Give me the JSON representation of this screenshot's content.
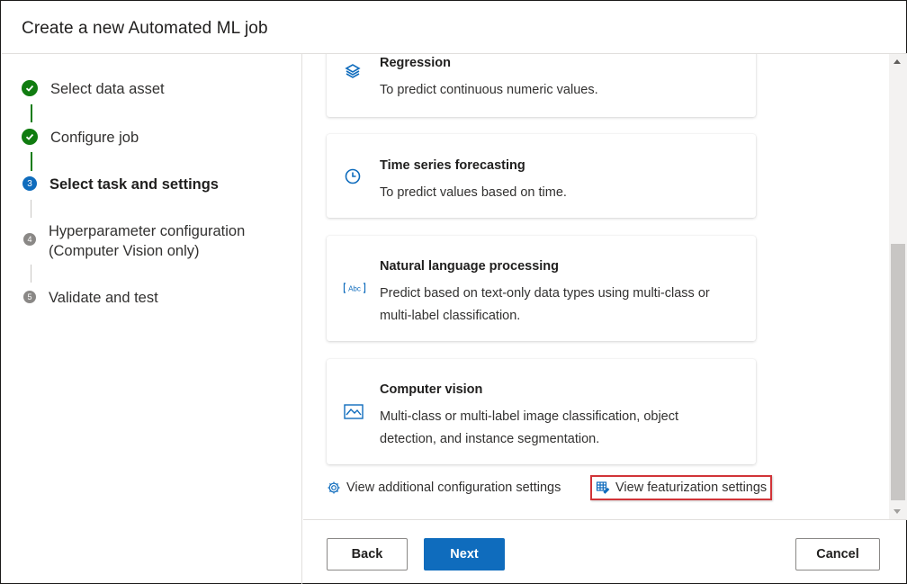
{
  "header": {
    "title": "Create a new Automated ML job"
  },
  "sidebar": {
    "steps": [
      {
        "label": "Select data asset",
        "status": "done",
        "number": "1"
      },
      {
        "label": "Configure job",
        "status": "done",
        "number": "2"
      },
      {
        "label": "Select task and settings",
        "status": "current",
        "number": "3"
      },
      {
        "label_line1": "Hyperparameter configuration",
        "label_line2": "(Computer Vision only)",
        "status": "todo",
        "number": "4"
      },
      {
        "label": "Validate and test",
        "status": "todo",
        "number": "5"
      }
    ]
  },
  "tasks": [
    {
      "icon": "regression-icon",
      "title": "Regression",
      "description": "To predict continuous numeric values."
    },
    {
      "icon": "clock-icon",
      "title": "Time series forecasting",
      "description": "To predict values based on time."
    },
    {
      "icon": "text-abc-icon",
      "title": "Natural language processing",
      "description": "Predict based on text-only data types using multi-class or multi-label classification."
    },
    {
      "icon": "image-icon",
      "title": "Computer vision",
      "description": "Multi-class or multi-label image classification, object detection, and instance segmentation."
    }
  ],
  "links": {
    "additional_config": "View additional configuration settings",
    "featurization": "View featurization settings"
  },
  "footer": {
    "back": "Back",
    "next": "Next",
    "cancel": "Cancel"
  },
  "colors": {
    "primary": "#0f6cbd",
    "success": "#107c10",
    "highlight_border": "#d13438",
    "pending": "#8a8886"
  }
}
